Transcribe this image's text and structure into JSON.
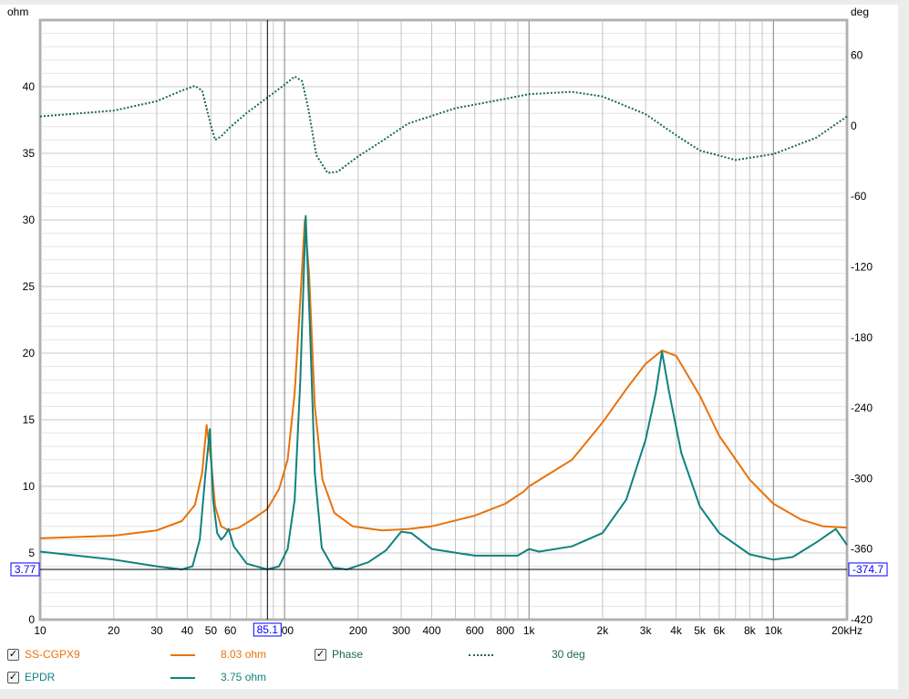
{
  "chart_data": {
    "type": "line",
    "x_scale": "log",
    "xlim": [
      10,
      20000
    ],
    "ylim": [
      0,
      45
    ],
    "y2lim": [
      -420,
      90
    ],
    "left_unit": "ohm",
    "right_unit": "deg",
    "x_ticks": [
      {
        "v": 10,
        "l": "10"
      },
      {
        "v": 20,
        "l": "20"
      },
      {
        "v": 30,
        "l": "30"
      },
      {
        "v": 40,
        "l": "40"
      },
      {
        "v": 50,
        "l": "50"
      },
      {
        "v": 60,
        "l": "60"
      },
      {
        "v": 100,
        "l": "100"
      },
      {
        "v": 200,
        "l": "200"
      },
      {
        "v": 300,
        "l": "300"
      },
      {
        "v": 400,
        "l": "400"
      },
      {
        "v": 600,
        "l": "600"
      },
      {
        "v": 800,
        "l": "800"
      },
      {
        "v": 1000,
        "l": "1k"
      },
      {
        "v": 2000,
        "l": "2k"
      },
      {
        "v": 3000,
        "l": "3k"
      },
      {
        "v": 4000,
        "l": "4k"
      },
      {
        "v": 5000,
        "l": "5k"
      },
      {
        "v": 6000,
        "l": "6k"
      },
      {
        "v": 8000,
        "l": "8k"
      },
      {
        "v": 10000,
        "l": "10k"
      },
      {
        "v": 20000,
        "l": "20kHz"
      }
    ],
    "y_ticks": [
      0,
      5,
      10,
      15,
      20,
      25,
      30,
      35,
      40
    ],
    "y2_ticks": [
      -420,
      -360,
      -300,
      -240,
      -180,
      -120,
      -60,
      0,
      60
    ],
    "cursor": {
      "x": 85.1,
      "x_label": "85.1",
      "y": 3.77,
      "y_label": "3.77",
      "y2_label": "-374.7"
    },
    "series": [
      {
        "name": "SS-CGPX9",
        "value_label": "8.03 ohm",
        "color": "#e8720c",
        "axis": "left",
        "style": "solid",
        "points": [
          [
            10,
            6.1
          ],
          [
            20,
            6.3
          ],
          [
            30,
            6.7
          ],
          [
            38,
            7.4
          ],
          [
            43,
            8.6
          ],
          [
            46,
            11
          ],
          [
            48,
            14.6
          ],
          [
            50,
            12
          ],
          [
            52,
            8.5
          ],
          [
            55,
            7
          ],
          [
            59,
            6.7
          ],
          [
            65,
            6.9
          ],
          [
            75,
            7.6
          ],
          [
            85,
            8.3
          ],
          [
            95,
            9.8
          ],
          [
            103,
            12
          ],
          [
            110,
            17
          ],
          [
            116,
            24
          ],
          [
            121,
            30
          ],
          [
            126,
            26
          ],
          [
            133,
            16
          ],
          [
            143,
            10.5
          ],
          [
            160,
            8
          ],
          [
            190,
            7
          ],
          [
            250,
            6.7
          ],
          [
            320,
            6.8
          ],
          [
            400,
            7
          ],
          [
            600,
            7.8
          ],
          [
            800,
            8.7
          ],
          [
            950,
            9.6
          ],
          [
            1000,
            10
          ],
          [
            1500,
            12
          ],
          [
            2000,
            14.8
          ],
          [
            2500,
            17.3
          ],
          [
            3000,
            19.2
          ],
          [
            3500,
            20.2
          ],
          [
            4000,
            19.8
          ],
          [
            5000,
            16.8
          ],
          [
            6000,
            13.8
          ],
          [
            8000,
            10.5
          ],
          [
            10000,
            8.7
          ],
          [
            13000,
            7.5
          ],
          [
            16000,
            7
          ],
          [
            20000,
            6.9
          ]
        ]
      },
      {
        "name": "EPDR",
        "value_label": "3.75 ohm",
        "color": "#10827e",
        "axis": "left",
        "style": "solid",
        "points": [
          [
            10,
            5.1
          ],
          [
            20,
            4.5
          ],
          [
            30,
            4
          ],
          [
            38,
            3.77
          ],
          [
            42,
            4
          ],
          [
            45,
            6
          ],
          [
            47.5,
            11
          ],
          [
            49.5,
            14.3
          ],
          [
            51,
            9
          ],
          [
            53,
            6.5
          ],
          [
            55,
            6
          ],
          [
            57,
            6.3
          ],
          [
            59,
            6.8
          ],
          [
            62,
            5.5
          ],
          [
            70,
            4.2
          ],
          [
            85,
            3.77
          ],
          [
            95,
            4
          ],
          [
            103,
            5.3
          ],
          [
            110,
            9
          ],
          [
            116,
            18
          ],
          [
            122,
            30.3
          ],
          [
            127,
            22
          ],
          [
            133,
            11
          ],
          [
            142,
            5.4
          ],
          [
            158,
            3.9
          ],
          [
            180,
            3.77
          ],
          [
            220,
            4.3
          ],
          [
            260,
            5.2
          ],
          [
            300,
            6.6
          ],
          [
            330,
            6.5
          ],
          [
            400,
            5.3
          ],
          [
            600,
            4.8
          ],
          [
            900,
            4.8
          ],
          [
            1000,
            5.3
          ],
          [
            1100,
            5.1
          ],
          [
            1500,
            5.5
          ],
          [
            2000,
            6.5
          ],
          [
            2500,
            9
          ],
          [
            3000,
            13.5
          ],
          [
            3300,
            17
          ],
          [
            3500,
            20.1
          ],
          [
            3750,
            17
          ],
          [
            4200,
            12.5
          ],
          [
            5000,
            8.5
          ],
          [
            6000,
            6.5
          ],
          [
            8000,
            4.9
          ],
          [
            10000,
            4.5
          ],
          [
            12000,
            4.7
          ],
          [
            15000,
            5.8
          ],
          [
            18000,
            6.8
          ],
          [
            20000,
            5.6
          ]
        ]
      },
      {
        "name": "Phase",
        "value_label": "30 deg",
        "color": "#1a6b45",
        "axis": "right",
        "style": "dotted",
        "points": [
          [
            10,
            8
          ],
          [
            20,
            13
          ],
          [
            30,
            21
          ],
          [
            38,
            30
          ],
          [
            43,
            34
          ],
          [
            46,
            30
          ],
          [
            48,
            15
          ],
          [
            50,
            0
          ],
          [
            52,
            -12
          ],
          [
            55,
            -9
          ],
          [
            60,
            -1
          ],
          [
            70,
            11
          ],
          [
            85,
            24
          ],
          [
            100,
            35
          ],
          [
            110,
            42
          ],
          [
            118,
            38
          ],
          [
            125,
            15
          ],
          [
            135,
            -25
          ],
          [
            150,
            -40
          ],
          [
            165,
            -39
          ],
          [
            200,
            -26
          ],
          [
            250,
            -13
          ],
          [
            320,
            2
          ],
          [
            500,
            15
          ],
          [
            800,
            23
          ],
          [
            1000,
            27
          ],
          [
            1500,
            29
          ],
          [
            2000,
            25
          ],
          [
            3000,
            10
          ],
          [
            4000,
            -8
          ],
          [
            5000,
            -21
          ],
          [
            7000,
            -29
          ],
          [
            10000,
            -24
          ],
          [
            15000,
            -10
          ],
          [
            20000,
            8
          ]
        ]
      }
    ]
  }
}
